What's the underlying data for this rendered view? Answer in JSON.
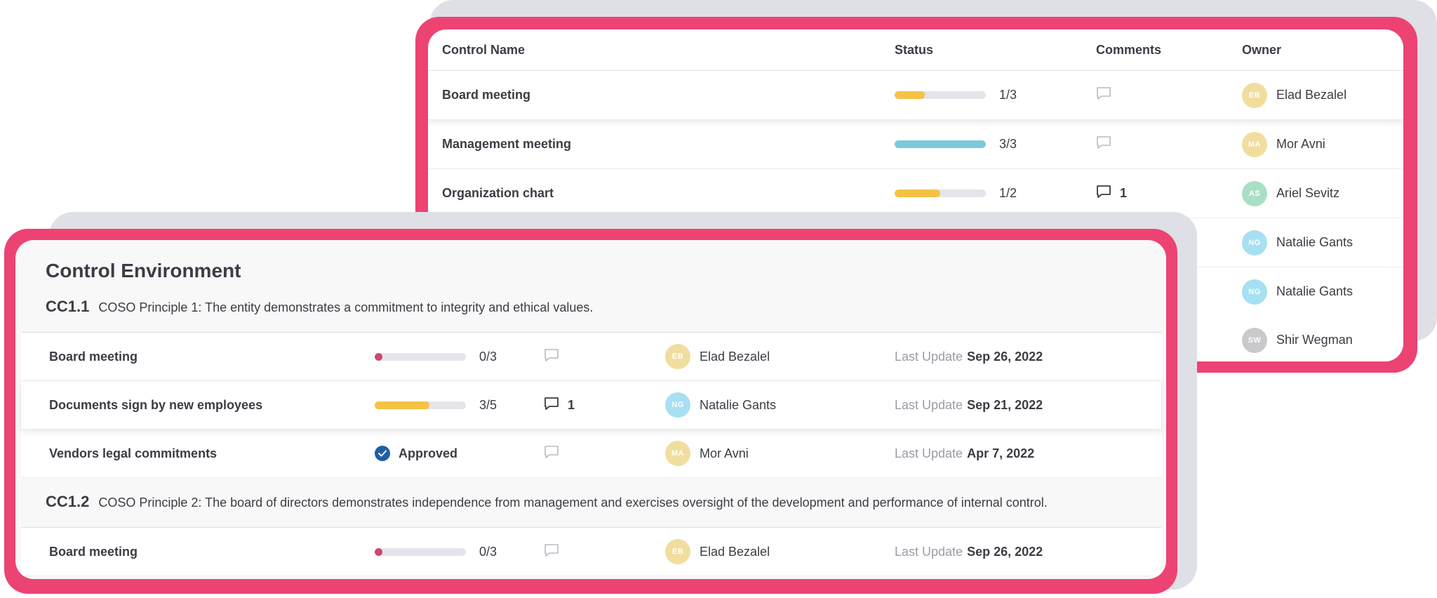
{
  "back_table": {
    "headers": {
      "name": "Control Name",
      "status": "Status",
      "comments": "Comments",
      "owner": "Owner"
    },
    "rows": [
      {
        "name": "Board meeting",
        "progress_label": "1/3",
        "progress": 0.33,
        "bar_color": "#f5c243",
        "comments": "",
        "avatar": "EB",
        "avatar_color": "#f1dd9e",
        "owner": "Elad Bezalel"
      },
      {
        "name": "Management meeting",
        "progress_label": "3/3",
        "progress": 1.0,
        "bar_color": "#7cc9dc",
        "comments": "",
        "avatar": "MA",
        "avatar_color": "#f1dd9e",
        "owner": "Mor Avni"
      },
      {
        "name": "Organization chart",
        "progress_label": "1/2",
        "progress": 0.5,
        "bar_color": "#f5c243",
        "comments": "1",
        "avatar": "AS",
        "avatar_color": "#a9dfc5",
        "owner": "Ariel Sevitz"
      },
      {
        "avatar": "NG",
        "avatar_color": "#a6e0f2",
        "owner": "Natalie Gants"
      },
      {
        "avatar": "NG",
        "avatar_color": "#a6e0f2",
        "owner": "Natalie Gants"
      },
      {
        "avatar": "SW",
        "avatar_color": "#c9c9cc",
        "owner": "Shir Wegman"
      }
    ]
  },
  "front_card": {
    "title": "Control Environment",
    "last_update_label": "Last Update",
    "sections": [
      {
        "code": "CC1.1",
        "description": "COSO Principle 1: The entity demonstrates a commitment to integrity and ethical values.",
        "rows": [
          {
            "name": "Board meeting",
            "progress_label": "0/3",
            "progress": 0.0,
            "bar_color": "#d2466b",
            "comments": "",
            "avatar": "EB",
            "avatar_color": "#f1dd9e",
            "owner": "Elad Bezalel",
            "last_update": "Sep 26, 2022"
          },
          {
            "name": "Documents sign by new employees",
            "progress_label": "3/5",
            "progress": 0.6,
            "bar_color": "#f5c243",
            "comments": "1",
            "avatar": "NG",
            "avatar_color": "#a6e0f2",
            "owner": "Natalie Gants",
            "last_update": "Sep 21, 2022"
          },
          {
            "name": "Vendors legal commitments",
            "status_text": "Approved",
            "comments": "",
            "avatar": "MA",
            "avatar_color": "#f1dd9e",
            "owner": "Mor Avni",
            "last_update": "Apr 7, 2022"
          }
        ]
      },
      {
        "code": "CC1.2",
        "description": "COSO Principle 2: The board of directors demonstrates independence from management and exercises oversight of the development and performance of internal control.",
        "rows": [
          {
            "name": "Board meeting",
            "progress_label": "0/3",
            "progress": 0.0,
            "bar_color": "#d2466b",
            "comments": "",
            "avatar": "EB",
            "avatar_color": "#f1dd9e",
            "owner": "Elad Bezalel",
            "last_update": "Sep 26, 2022"
          }
        ]
      }
    ]
  },
  "colors": {
    "frame": "#ec4373",
    "shadow": "#dfe0e6",
    "approved_check": "#1f5fa6"
  },
  "icons": {
    "comment": "comment-icon",
    "approved": "check-circle-icon"
  }
}
